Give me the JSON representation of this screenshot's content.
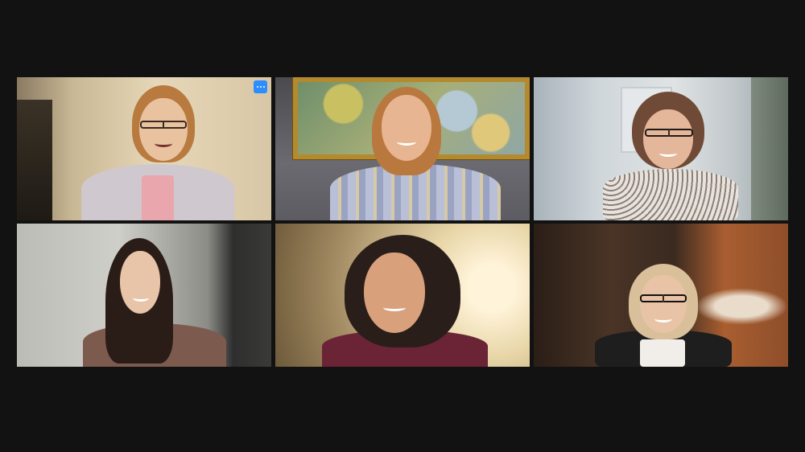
{
  "app": {
    "background_color": "#121212",
    "active_speaker_color": "#3ed23e",
    "accent_color": "#2d8cff"
  },
  "participants": [
    {
      "tile": 1,
      "active_speaker": false,
      "has_more_options_button": true
    },
    {
      "tile": 2,
      "active_speaker": false,
      "has_more_options_button": false
    },
    {
      "tile": 3,
      "active_speaker": true,
      "has_more_options_button": false
    },
    {
      "tile": 4,
      "active_speaker": false,
      "has_more_options_button": false
    },
    {
      "tile": 5,
      "active_speaker": false,
      "has_more_options_button": false
    },
    {
      "tile": 6,
      "active_speaker": false,
      "has_more_options_button": false
    }
  ],
  "icons": {
    "more_options": "more-options-icon"
  }
}
